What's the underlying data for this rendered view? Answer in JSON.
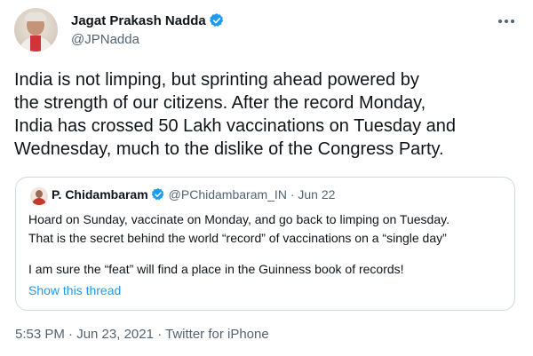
{
  "author": {
    "name": "Jagat Prakash Nadda",
    "handle": "@JPNadda"
  },
  "tweet": {
    "lines": [
      "India is not limping, but sprinting ahead powered by",
      "the strength of our citizens. After the record Monday,",
      "India has crossed 50 Lakh vaccinations on Tuesday and",
      "Wednesday, much to the dislike of the Congress Party."
    ]
  },
  "quote": {
    "name": "P. Chidambaram",
    "meta": "@PChidambaram_IN · Jun 22",
    "lines": [
      "Hoard on Sunday, vaccinate on Monday, and go back to limping on Tuesday.",
      "That is the secret behind the world “record” of vaccinations on a “single day”",
      "I am sure the “feat” will find a place in the Guinness book of records!"
    ],
    "show_thread": "Show this thread"
  },
  "footer": {
    "meta": "5:53 PM · Jun 23, 2021 · Twitter for iPhone"
  },
  "icons": {
    "verified": "verified-badge-icon",
    "more": "more-options-icon"
  },
  "colors": {
    "verified": "#1d9bf0",
    "link": "#1d9bf0",
    "secondary_text": "#536471",
    "border": "#cfd9de"
  }
}
